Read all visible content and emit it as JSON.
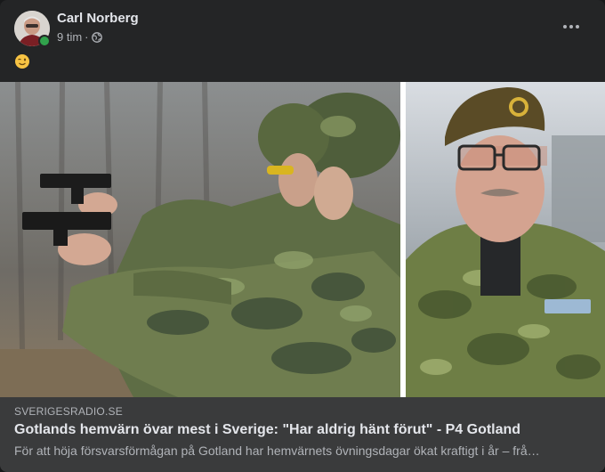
{
  "post": {
    "author": "Carl Norberg",
    "time": "9 tim",
    "separator": "·",
    "privacy_icon": "globe-icon",
    "menu_icon": "more-dots-icon",
    "text_icon": "winking-face-emoji"
  },
  "link": {
    "domain": "SVERIGESRADIO.SE",
    "title": "Gotlands hemvärn övar mest i Sverige: \"Har aldrig hänt förut\" - P4 Gotland",
    "description": "För att höja försvarsförmågan på Gotland har hemvärnets övningsdagar ökat kraftigt i år – frå…"
  },
  "colors": {
    "card_bg": "#242526",
    "preview_bg": "#3a3b3c",
    "text_primary": "#e4e6eb",
    "text_secondary": "#b0b3b8",
    "online": "#31a24c"
  }
}
